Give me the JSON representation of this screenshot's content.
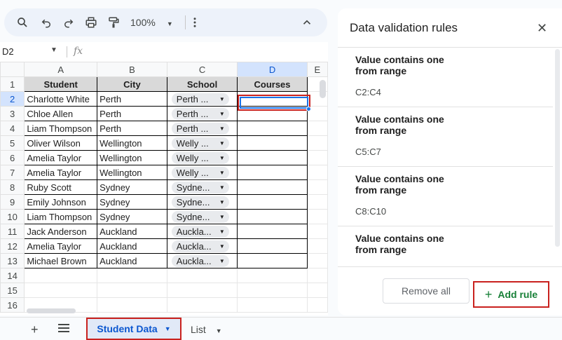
{
  "toolbar": {
    "zoom": "100%"
  },
  "namebox": {
    "cell": "D2",
    "fx": "fx"
  },
  "columns": [
    "A",
    "B",
    "C",
    "D",
    "E"
  ],
  "header_row": {
    "num": "1",
    "student": "Student",
    "city": "City",
    "school": "School",
    "courses": "Courses"
  },
  "rows": [
    {
      "num": "2",
      "student": "Charlotte White",
      "city": "Perth",
      "school": "Perth ..."
    },
    {
      "num": "3",
      "student": "Chloe Allen",
      "city": "Perth",
      "school": "Perth ..."
    },
    {
      "num": "4",
      "student": "Liam Thompson",
      "city": "Perth",
      "school": "Perth ..."
    },
    {
      "num": "5",
      "student": "Oliver Wilson",
      "city": "Wellington",
      "school": "Welly ..."
    },
    {
      "num": "6",
      "student": "Amelia Taylor",
      "city": "Wellington",
      "school": "Welly ..."
    },
    {
      "num": "7",
      "student": "Amelia Taylor",
      "city": "Wellington",
      "school": "Welly ..."
    },
    {
      "num": "8",
      "student": "Ruby Scott",
      "city": "Sydney",
      "school": "Sydne..."
    },
    {
      "num": "9",
      "student": "Emily Johnson",
      "city": "Sydney",
      "school": "Sydne..."
    },
    {
      "num": "10",
      "student": "Liam Thompson",
      "city": "Sydney",
      "school": "Sydne..."
    },
    {
      "num": "11",
      "student": "Jack Anderson",
      "city": "Auckland",
      "school": "Auckla..."
    },
    {
      "num": "12",
      "student": "Amelia Taylor",
      "city": "Auckland",
      "school": "Auckla..."
    },
    {
      "num": "13",
      "student": "Michael Brown",
      "city": "Auckland",
      "school": "Auckla..."
    }
  ],
  "empty_rows": [
    "14",
    "15",
    "16"
  ],
  "sheet_tabs": {
    "active": "Student Data",
    "other": "List"
  },
  "panel": {
    "title": "Data validation rules",
    "rules": [
      {
        "text": "Value contains one from range",
        "range": "C2:C4"
      },
      {
        "text": "Value contains one from range",
        "range": "C5:C7"
      },
      {
        "text": "Value contains one from range",
        "range": "C8:C10"
      },
      {
        "text": "Value contains one from range",
        "range": ""
      }
    ],
    "remove_all": "Remove all",
    "add_rule": "Add rule"
  },
  "colors": {
    "accent": "#0b57d0",
    "highlight": "#c9211e",
    "add_green": "#188038"
  }
}
